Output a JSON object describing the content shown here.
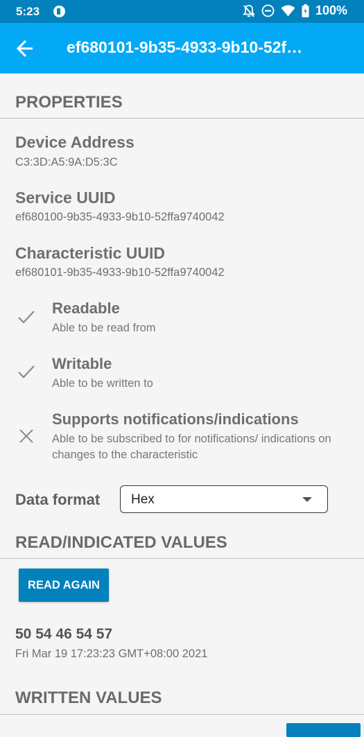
{
  "status_bar": {
    "time": "5:23",
    "battery": "100%",
    "icons": [
      "app-icon",
      "notifications-off-icon",
      "do-not-disturb-icon",
      "wifi-icon",
      "battery-icon"
    ]
  },
  "app_bar": {
    "title": "ef680101-9b35-4933-9b10-52f…"
  },
  "properties": {
    "header": "PROPERTIES",
    "device_address_label": "Device Address",
    "device_address_value": "C3:3D:A5:9A:D5:3C",
    "service_uuid_label": "Service UUID",
    "service_uuid_value": "ef680100-9b35-4933-9b10-52ffa9740042",
    "characteristic_uuid_label": "Characteristic UUID",
    "characteristic_uuid_value": "ef680101-9b35-4933-9b10-52ffa9740042"
  },
  "capabilities": [
    {
      "title": "Readable",
      "description": "Able to be read from",
      "icon": "check-icon"
    },
    {
      "title": "Writable",
      "description": "Able to be written to",
      "icon": "check-icon"
    },
    {
      "title": "Supports notifications/indications",
      "description": "Able to be subscribed to for notifications/ indications on changes to the characteristic",
      "icon": "close-icon"
    }
  ],
  "data_format": {
    "label": "Data format",
    "selected": "Hex"
  },
  "read_values": {
    "header": "READ/INDICATED VALUES",
    "button_label": "READ AGAIN",
    "value": "50 54 46 54 57",
    "timestamp": "Fri Mar 19 17:23:23 GMT+08:00 2021"
  },
  "written_values": {
    "header": "WRITTEN VALUES"
  },
  "colors": {
    "status_bar": "#0281bd",
    "app_bar": "#03a9f4",
    "accent_button": "#0281bd",
    "background": "#f5f5f5"
  }
}
